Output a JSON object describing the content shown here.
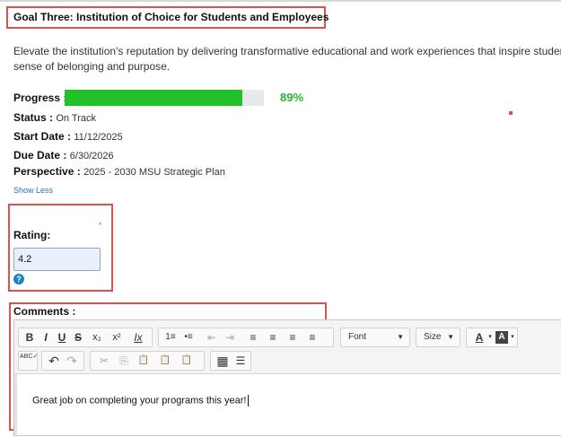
{
  "goal": {
    "title": "Goal Three: Institution of Choice for Students and Employees",
    "description_line1": "Elevate the institution's reputation by delivering transformative educational and work experiences that inspire students",
    "description_line2": "sense of belonging and purpose."
  },
  "progress": {
    "label": "Progress :",
    "percent_text": "89%",
    "value": 0.89,
    "fill_color": "#22c02a"
  },
  "details": {
    "status_label": "Status :",
    "status_value": "On Track",
    "start_label": "Start Date :",
    "start_value": "11/12/2025",
    "due_label": "Due Date :",
    "due_value": "6/30/2026",
    "perspective_label": "Perspective :",
    "perspective_value": "2025 - 2030 MSU Strategic Plan"
  },
  "show_less_label": "Show Less",
  "rating": {
    "label": "Rating:",
    "required_mark": "*",
    "value": "4.2",
    "help_icon": "question-circle-icon"
  },
  "comments": {
    "label": "Comments :",
    "text": "Great job on completing your programs this year!",
    "font_select": "Font",
    "size_select": "Size",
    "toolbar": {
      "bold": "B",
      "italic": "I",
      "underline": "U",
      "strike": "S",
      "subscript": "x₂",
      "superscript": "x²",
      "remove_format": "Ix",
      "numbered_list": "1≡",
      "bulleted_list": "•≡",
      "decrease_indent": "⇤",
      "increase_indent": "⇥",
      "align_left": "≡",
      "align_center": "≡",
      "align_right": "≡",
      "justify": "≡",
      "text_color": "A",
      "bg_color": "A",
      "spellcheck": "ABC✓",
      "undo": "↶",
      "redo": "↷",
      "cut": "✂",
      "copy": "⎘",
      "paste": "📋",
      "paste_text": "📋",
      "paste_word": "📋",
      "table": "▦",
      "hr": "☰"
    }
  },
  "colors": {
    "highlight_border": "#d9534f",
    "link": "#2a6db5",
    "progress_text": "#2cb02c"
  }
}
